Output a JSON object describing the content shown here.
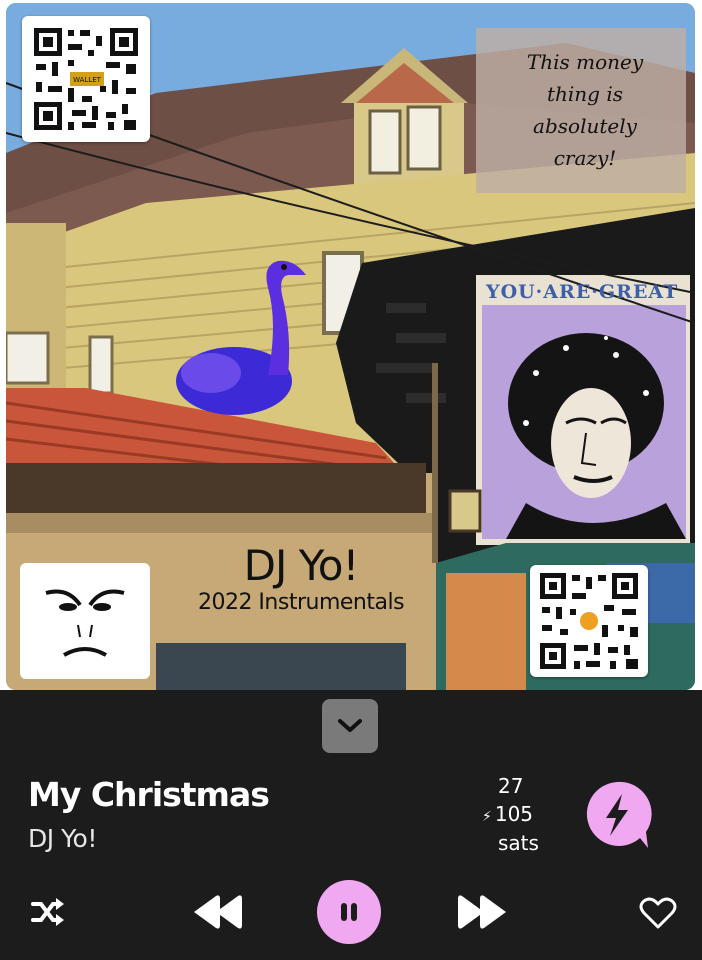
{
  "album_art": {
    "quote": "This money thing is absolutely crazy!",
    "artist_text": "DJ Yo!",
    "subtitle_text": "2022 Instrumentals",
    "mural_banner": "YOU·ARE·GREAT",
    "qr_top_left_label": "WALLET",
    "icons": [
      "qr-code-icon",
      "angry-face-icon",
      "ostrich-icon"
    ]
  },
  "player": {
    "track_title": "My Christmas",
    "track_artist": "DJ Yo!",
    "boost_count": "27",
    "sats_amount": "105",
    "sats_unit": "sats",
    "bolt_glyph": "⚡",
    "accent_color": "#f0a8f0",
    "background_color": "#1c1c1c",
    "controls": [
      "shuffle-icon",
      "previous-icon",
      "pause-icon",
      "next-icon",
      "heart-icon"
    ],
    "collapse_icon": "chevron-down-icon",
    "zap_icon": "lightning-bolt-icon"
  }
}
